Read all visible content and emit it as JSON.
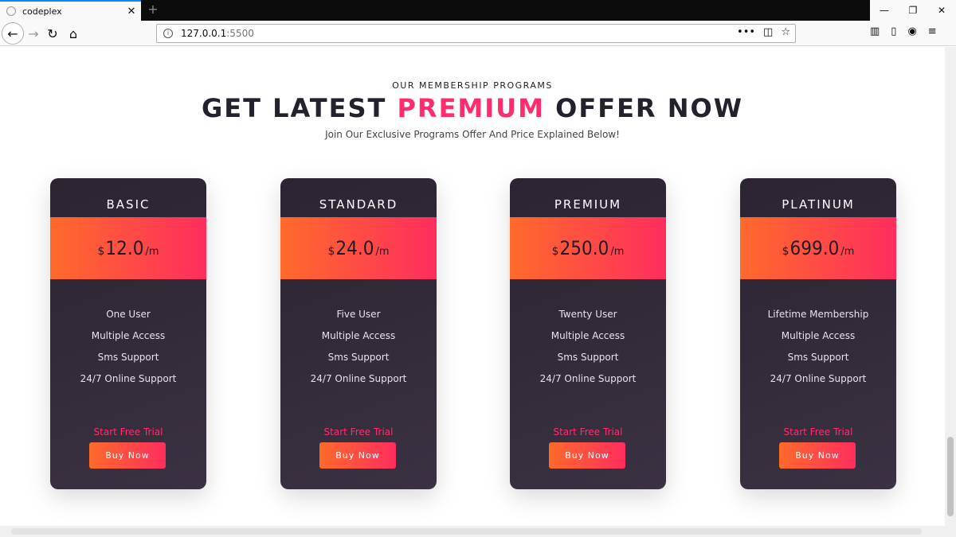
{
  "browser": {
    "tab_title": "codeplex",
    "tab_close": "✕",
    "new_tab": "+",
    "url_host": "127.0.0.1",
    "url_port": ":5500",
    "win_min": "—",
    "win_max": "❐",
    "win_close": "✕"
  },
  "hero": {
    "eyebrow": "OUR MEMBERSHIP PROGRAMS",
    "title_before": "GET LATEST ",
    "title_accent": "PREMIUM",
    "title_after": " OFFER NOW",
    "subtitle": "Join Our Exclusive Programs Offer And Price Explained Below!"
  },
  "plans": [
    {
      "name": "BASIC",
      "currency": "$",
      "price": "12.0",
      "period": "/m",
      "features": [
        "One User",
        "Multiple Access",
        "Sms Support",
        "24/7 Online Support"
      ],
      "trial": "Start Free Trial",
      "cta": "Buy Now"
    },
    {
      "name": "STANDARD",
      "currency": "$",
      "price": "24.0",
      "period": "/m",
      "features": [
        "Five User",
        "Multiple Access",
        "Sms Support",
        "24/7 Online Support"
      ],
      "trial": "Start Free Trial",
      "cta": "Buy Now"
    },
    {
      "name": "PREMIUM",
      "currency": "$",
      "price": "250.0",
      "period": "/m",
      "features": [
        "Twenty User",
        "Multiple Access",
        "Sms Support",
        "24/7 Online Support"
      ],
      "trial": "Start Free Trial",
      "cta": "Buy Now"
    },
    {
      "name": "PLATINUM",
      "currency": "$",
      "price": "699.0",
      "period": "/m",
      "features": [
        "Lifetime Membership",
        "Multiple Access",
        "Sms Support",
        "24/7 Online Support"
      ],
      "trial": "Start Free Trial",
      "cta": "Buy Now"
    }
  ],
  "colors": {
    "accent": "#ff2d6c",
    "gradient_start": "#ff6a2b",
    "gradient_end": "#ff2d5e",
    "card_bg": "#2c2430"
  }
}
